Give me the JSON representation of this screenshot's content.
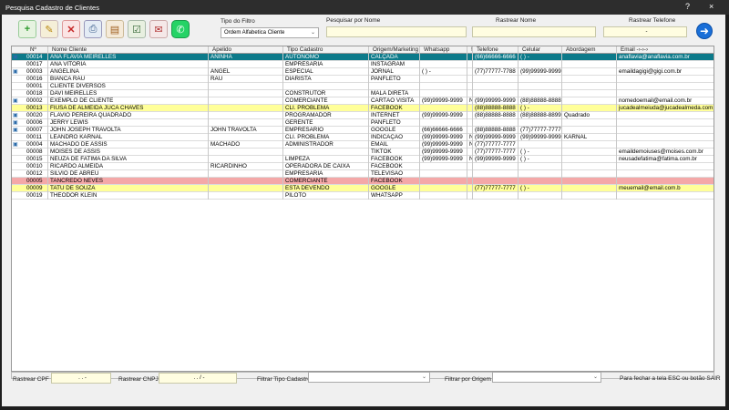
{
  "window": {
    "title": "Pesquisa Cadastro de Clientes",
    "help": "?",
    "close": "×"
  },
  "filter": {
    "tipo_label": "Tipo do Filtro",
    "tipo_value": "Ordem Alfabetica Cliente",
    "nome_label": "Pesquisar por Nome",
    "rastrear_nome_label": "Rastrear Nome",
    "rastrear_tel_label": "Rastrear Telefone",
    "rastrear_tel_value": "-"
  },
  "columns": [
    "Nº",
    "Nome Cliente",
    "Apelido",
    "Tipo Cadastro",
    "Origem/Marketing",
    "Whatsapp",
    "!",
    "Telefone",
    "Celular",
    "Abordagem",
    "Email -›-›-›"
  ],
  "rows": [
    {
      "n": "00014",
      "nome": "ANA FLAVIA MEIRELLES",
      "apelido": "ANINHA",
      "tipo": "AUTONOMO",
      "origem": "CALÇADA",
      "whats": "",
      "f": "",
      "tel": "(66)66666-6666",
      "cel": "( ) -",
      "abord": "",
      "email": "anaflavia@anaflavia.com.br",
      "style": "sel",
      "icon": true
    },
    {
      "n": "00017",
      "nome": "ANA VITORIA",
      "apelido": "",
      "tipo": "EMPRESARIA",
      "origem": "INSTAGRAM",
      "whats": "",
      "f": "",
      "tel": "",
      "cel": "",
      "abord": "",
      "email": "",
      "style": "wht",
      "icon": false
    },
    {
      "n": "00003",
      "nome": "ANGELINA",
      "apelido": "ANGEL",
      "tipo": "ESPECIAL",
      "origem": "JORNAL",
      "whats": "( ) -",
      "f": "",
      "tel": "(77)77777-7788",
      "cel": "(99)99999-9999",
      "abord": "",
      "email": "emaildagigi@gigi.com.br",
      "style": "wht",
      "icon": true
    },
    {
      "n": "00016",
      "nome": "BIANCA RAU",
      "apelido": "RAU",
      "tipo": "DIARISTA",
      "origem": "PANFLETO",
      "whats": "",
      "f": "",
      "tel": "",
      "cel": "",
      "abord": "",
      "email": "",
      "style": "wht",
      "icon": false
    },
    {
      "n": "00001",
      "nome": "CLIENTE DIVERSOS",
      "apelido": "",
      "tipo": "",
      "origem": "",
      "whats": "",
      "f": "",
      "tel": "",
      "cel": "",
      "abord": "",
      "email": "",
      "style": "wht",
      "icon": false
    },
    {
      "n": "00018",
      "nome": "DAVI MEIRELLES",
      "apelido": "",
      "tipo": "CONSTRUTOR",
      "origem": "MALA DIRETA",
      "whats": "",
      "f": "",
      "tel": "",
      "cel": "",
      "abord": "",
      "email": "",
      "style": "wht",
      "icon": false
    },
    {
      "n": "00002",
      "nome": "EXEMPLO DE CLIENTE",
      "apelido": "",
      "tipo": "COMERCIANTE",
      "origem": "CARTÃO VISITA",
      "whats": "(99)99999-9999",
      "f": "N",
      "tel": "(99)99999-9999",
      "cel": "(88)88888-8888",
      "abord": "",
      "email": "nomedoemail@email.com.br",
      "style": "wht",
      "icon": true
    },
    {
      "n": "00013",
      "nome": "FIUSA DE ALMEIDA JUCA CHAVES",
      "apelido": "",
      "tipo": "CLI. PROBLEMA",
      "origem": "FACEBOOK",
      "whats": "",
      "f": "",
      "tel": "(88)88888-8888",
      "cel": "( ) -",
      "abord": "",
      "email": "jucadealmeiuda@jucadealmeda.com.br",
      "style": "yel",
      "icon": false
    },
    {
      "n": "00020",
      "nome": "FLAVIO PEREIRA QUADRADO",
      "apelido": "",
      "tipo": "PROGRAMADOR",
      "origem": "INTERNET",
      "whats": "(99)99999-9999",
      "f": "",
      "tel": "(88)88888-8888",
      "cel": "(88)88888-8899",
      "abord": "Quadrado",
      "email": "",
      "style": "wht",
      "icon": true
    },
    {
      "n": "00006",
      "nome": "JERRY LEWIS",
      "apelido": "",
      "tipo": "GERENTE",
      "origem": "PANFLETO",
      "whats": "",
      "f": "",
      "tel": "",
      "cel": "",
      "abord": "",
      "email": "",
      "style": "wht",
      "icon": true
    },
    {
      "n": "00007",
      "nome": "JOHN JOSEPH TRAVOLTA",
      "apelido": "JOHN TRAVOLTA",
      "tipo": "EMPRESARIO",
      "origem": "GOOGLE",
      "whats": "(66)66666-6666",
      "f": "",
      "tel": "(88)88888-8888",
      "cel": "(77)77777-7777",
      "abord": "",
      "email": "",
      "style": "wht",
      "icon": true
    },
    {
      "n": "00011",
      "nome": "LEANDRO KARNAL",
      "apelido": "",
      "tipo": "CLI. PROBLEMA",
      "origem": "INDICAÇÃO",
      "whats": "(99)99999-9999",
      "f": "N",
      "tel": "(99)99999-9999",
      "cel": "(99)99999-9999",
      "abord": "KARNAL",
      "email": "",
      "style": "wht",
      "icon": false
    },
    {
      "n": "00004",
      "nome": "MACHADO DE ASSIS",
      "apelido": "MACHADO",
      "tipo": "ADMINISTRADOR",
      "origem": "EMAIL",
      "whats": "(99)99999-9999",
      "f": "N",
      "tel": "(77)77777-7777",
      "cel": "",
      "abord": "",
      "email": "",
      "style": "wht",
      "icon": true
    },
    {
      "n": "00008",
      "nome": "MOISES DE ASSIS",
      "apelido": "",
      "tipo": "",
      "origem": "TIKTOK",
      "whats": "(99)99999-9999",
      "f": "",
      "tel": "(77)77777-7777",
      "cel": "( ) -",
      "abord": "",
      "email": "emaildemoiuses@moises.com.br",
      "style": "wht",
      "icon": false
    },
    {
      "n": "00015",
      "nome": "NEUZA DE FATIMA DA SILVA",
      "apelido": "",
      "tipo": "LIMPEZA",
      "origem": "FACEBOOK",
      "whats": "(99)99999-9999",
      "f": "N",
      "tel": "(99)99999-9999",
      "cel": "( ) -",
      "abord": "",
      "email": "neusadefatima@fatima.com.br",
      "style": "wht",
      "icon": false
    },
    {
      "n": "00010",
      "nome": "RICARDO ALMEIDA",
      "apelido": "RICARDINHO",
      "tipo": "OPERADORA DE CAIXA",
      "origem": "FACEBOOK",
      "whats": "",
      "f": "",
      "tel": "",
      "cel": "",
      "abord": "",
      "email": "",
      "style": "wht",
      "icon": false
    },
    {
      "n": "00012",
      "nome": "SILVIO DE ABREU",
      "apelido": "",
      "tipo": "EMPRESARIA",
      "origem": "TELEVISÃO",
      "whats": "",
      "f": "",
      "tel": "",
      "cel": "",
      "abord": "",
      "email": "",
      "style": "wht",
      "icon": false
    },
    {
      "n": "00005",
      "nome": "TANCREDO NEVES",
      "apelido": "",
      "tipo": "COMERCIANTE",
      "origem": "FACEBOOK",
      "whats": "",
      "f": "",
      "tel": "",
      "cel": "",
      "abord": "",
      "email": "",
      "style": "red",
      "icon": false
    },
    {
      "n": "00009",
      "nome": "TATU DE SOUZA",
      "apelido": "",
      "tipo": "ESTA DEVENDO",
      "origem": "GOOGLE",
      "whats": "",
      "f": "",
      "tel": "(77)77777-7777",
      "cel": "( ) -",
      "abord": "",
      "email": "meuemail@email.com.b",
      "style": "yel",
      "icon": false
    },
    {
      "n": "00019",
      "nome": "THEODOR KLEIN",
      "apelido": "",
      "tipo": "PILOTO",
      "origem": "WHATSAPP",
      "whats": "",
      "f": "",
      "tel": "",
      "cel": "",
      "abord": "",
      "email": "",
      "style": "wht",
      "icon": false
    }
  ],
  "footer": {
    "cpf_label": "Rastrear CPF",
    "cpf_value": ". . -",
    "cnpj_label": "Rastrear CNPJ",
    "cnpj_value": ". . / -",
    "tipo_cad_label": "Filtrar Tipo Cadastro",
    "origem_label": "Filtrar por Origem",
    "hint": "Para fechar a tela ESC ou botão SAIR"
  },
  "colors": {
    "selected": "#0c7a8a",
    "highlight_yellow": "#ffff99",
    "highlight_red": "#f4a8a8"
  },
  "icons": [
    "add-icon",
    "edit-icon",
    "delete-icon",
    "print-icon",
    "archive-icon",
    "checklist-icon",
    "email-icon",
    "whatsapp-icon",
    "go-arrow-icon",
    "contact-card-icon"
  ]
}
